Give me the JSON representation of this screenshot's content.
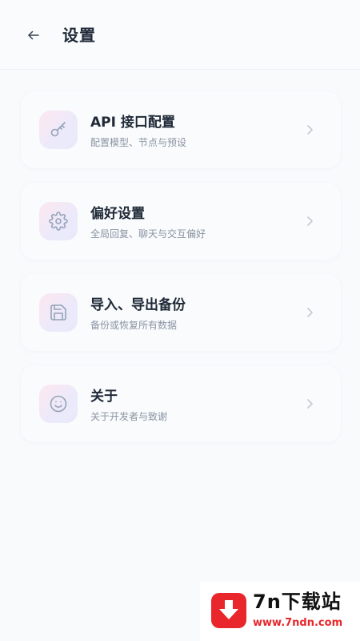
{
  "header": {
    "back_icon": "arrow-left-icon",
    "title": "设置"
  },
  "menu": [
    {
      "icon": "key-icon",
      "title": "API 接口配置",
      "subtitle": "配置模型、节点与预设"
    },
    {
      "icon": "gear-icon",
      "title": "偏好设置",
      "subtitle": "全局回复、聊天与交互偏好"
    },
    {
      "icon": "save-icon",
      "title": "导入、导出备份",
      "subtitle": "备份或恢复所有数据"
    },
    {
      "icon": "smile-icon",
      "title": "关于",
      "subtitle": "关于开发者与致谢"
    }
  ],
  "watermark": {
    "name": "7n下载站",
    "url": "www.7ndn.com",
    "icon": "download-arrow-icon"
  },
  "colors": {
    "background": "#f8fafc",
    "title_text": "#1f2937",
    "subtitle_text": "#8a94a3",
    "icon_stroke": "#94a3b8",
    "watermark_red": "#e8262b"
  }
}
